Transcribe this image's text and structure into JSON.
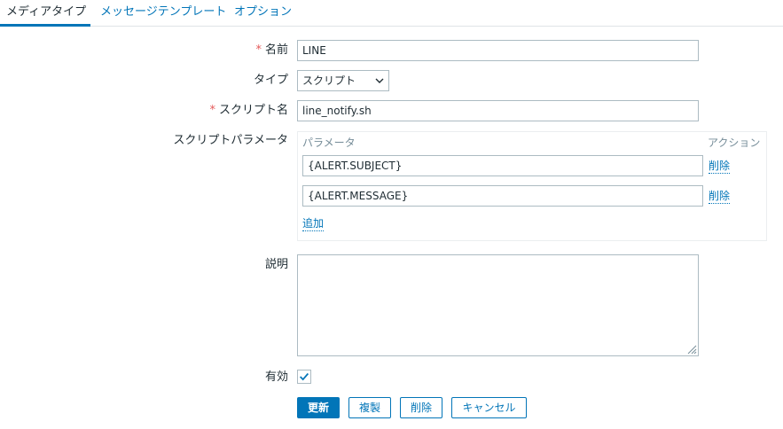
{
  "tabs": [
    {
      "label": "メディアタイプ"
    },
    {
      "label": "メッセージテンプレート"
    },
    {
      "label": "オプション"
    }
  ],
  "form": {
    "name": {
      "label": "名前",
      "value": "LINE"
    },
    "type": {
      "label": "タイプ",
      "selected": "スクリプト"
    },
    "script_name": {
      "label": "スクリプト名",
      "value": "line_notify.sh"
    },
    "script_params": {
      "label": "スクリプトパラメータ",
      "col_param": "パラメータ",
      "col_action": "アクション",
      "rows": [
        {
          "value": "{ALERT.SUBJECT}",
          "action": "削除"
        },
        {
          "value": "{ALERT.MESSAGE}",
          "action": "削除"
        }
      ],
      "add_label": "追加"
    },
    "description": {
      "label": "説明",
      "value": ""
    },
    "enabled": {
      "label": "有効",
      "checked": true
    },
    "required_mark": "*"
  },
  "buttons": {
    "update": "更新",
    "clone": "複製",
    "delete": "削除",
    "cancel": "キャンセル"
  },
  "colors": {
    "accent": "#0275b8",
    "required": "#e45959",
    "border": "#acbbc2"
  }
}
